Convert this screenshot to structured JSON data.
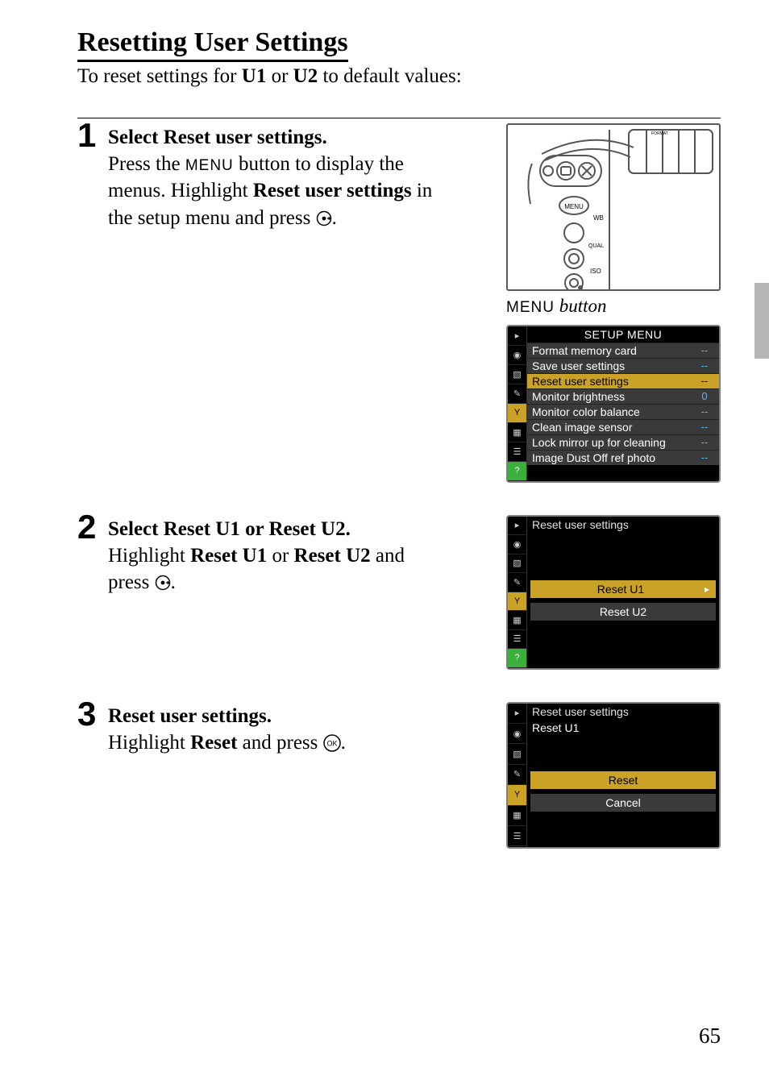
{
  "title": "Resetting User Settings",
  "intro_pre": "To reset settings for ",
  "intro_b1": "U1",
  "intro_mid": " or ",
  "intro_b2": "U2",
  "intro_post": " to default values:",
  "page_number": "65",
  "menu_word": "MENU",
  "menu_button_label": " button",
  "steps": {
    "s1": {
      "num": "1",
      "head_pre": "Select ",
      "head_b": "Reset user settings",
      "head_post": ".",
      "t1": "Press the ",
      "t2": " button to display the menus. Highlight ",
      "t3": "Reset user settings",
      "t4": " in the setup menu and press "
    },
    "s2": {
      "num": "2",
      "head_pre": "Select ",
      "head_b1": "Reset U1",
      "head_mid": " or ",
      "head_b2": "Reset U2",
      "head_post": ".",
      "t1": "Highlight ",
      "t2": "Reset U1",
      "t3": " or ",
      "t4": "Reset U2",
      "t5": " and press "
    },
    "s3": {
      "num": "3",
      "head": "Reset user settings.",
      "t1": "Highlight ",
      "t2": "Reset",
      "t3": " and press "
    }
  },
  "lcd_setup": {
    "title": "SETUP MENU",
    "rows": [
      {
        "label": "Format memory card",
        "val": "--"
      },
      {
        "label": "Save user settings",
        "val": "--"
      },
      {
        "label": "Reset user settings",
        "val": "--",
        "selected": true
      },
      {
        "label": "Monitor brightness",
        "val": "0"
      },
      {
        "label": "Monitor color balance",
        "val": "--"
      },
      {
        "label": "Clean image sensor",
        "val": "--"
      },
      {
        "label": "Lock mirror up for cleaning",
        "val": "--"
      },
      {
        "label": "Image Dust Off ref photo",
        "val": "--"
      }
    ]
  },
  "lcd_reset_pick": {
    "title": "Reset user settings",
    "opt1": "Reset U1",
    "opt2": "Reset U2"
  },
  "lcd_reset_confirm": {
    "title": "Reset user settings",
    "subtitle": "Reset U1",
    "opt1": "Reset",
    "opt2": "Cancel"
  },
  "side_tabs": [
    "▸",
    "◉",
    "▧",
    "✎",
    "Y",
    "▦",
    "☰",
    "?"
  ],
  "cam_labels": {
    "wb": "WB",
    "qual": "QUAL",
    "iso": "ISO",
    "menu": "MENU",
    "format": "FORMAT"
  }
}
